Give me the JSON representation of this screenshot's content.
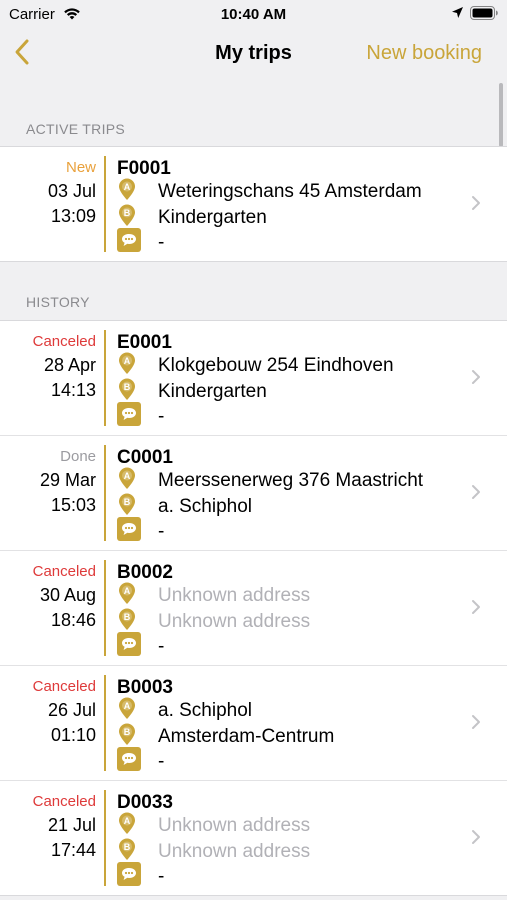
{
  "status_bar": {
    "carrier": "Carrier",
    "time": "10:40 AM"
  },
  "nav": {
    "title": "My trips",
    "new_booking": "New booking"
  },
  "sections": {
    "active": "ACTIVE TRIPS",
    "history": "HISTORY"
  },
  "colors": {
    "accent": "#c9a53a",
    "new": "#e9a13c",
    "canceled": "#de3a3a",
    "done": "#9b9ba0"
  },
  "active_trips": [
    {
      "status": "New",
      "date": "03 Jul",
      "time": "13:09",
      "code": "F0001",
      "from": "Weteringschans 45 Amsterdam",
      "to": "Kindergarten",
      "note": "-"
    }
  ],
  "history": [
    {
      "status": "Canceled",
      "date": "28 Apr",
      "time": "14:13",
      "code": "E0001",
      "from": "Klokgebouw 254 Eindhoven",
      "to": "Kindergarten",
      "note": "-"
    },
    {
      "status": "Done",
      "date": "29 Mar",
      "time": "15:03",
      "code": "C0001",
      "from": "Meerssenerweg 376 Maastricht",
      "to": "a. Schiphol",
      "note": "-"
    },
    {
      "status": "Canceled",
      "date": "30 Aug",
      "time": "18:46",
      "code": "B0002",
      "from": "Unknown address",
      "to": "Unknown address",
      "note": "-"
    },
    {
      "status": "Canceled",
      "date": "26 Jul",
      "time": "01:10",
      "code": "B0003",
      "from": "a. Schiphol",
      "to": "Amsterdam-Centrum",
      "note": "-"
    },
    {
      "status": "Canceled",
      "date": "21 Jul",
      "time": "17:44",
      "code": "D0033",
      "from": "Unknown address",
      "to": "Unknown address",
      "note": "-"
    }
  ]
}
